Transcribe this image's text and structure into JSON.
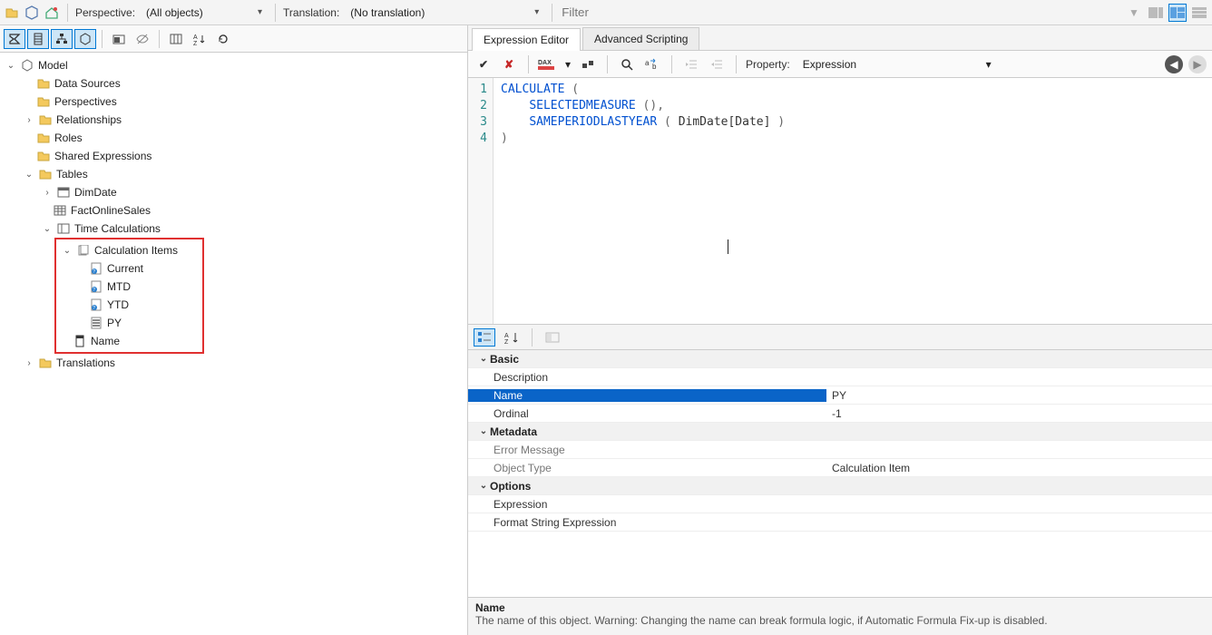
{
  "top": {
    "perspective_label": "Perspective:",
    "perspective_value": "(All objects)",
    "translation_label": "Translation:",
    "translation_value": "(No translation)",
    "filter_placeholder": "Filter"
  },
  "tree": {
    "root": "Model",
    "data_sources": "Data Sources",
    "perspectives": "Perspectives",
    "relationships": "Relationships",
    "roles": "Roles",
    "shared_expr": "Shared Expressions",
    "tables": "Tables",
    "dimdate": "DimDate",
    "factonlinesales": "FactOnlineSales",
    "timecalc": "Time Calculations",
    "calcitems": "Calculation Items",
    "ci_current": "Current",
    "ci_mtd": "MTD",
    "ci_ytd": "YTD",
    "ci_py": "PY",
    "namecol": "Name",
    "translations": "Translations"
  },
  "tabs": {
    "expr_editor": "Expression Editor",
    "adv_scripting": "Advanced Scripting"
  },
  "editor_toolbar": {
    "property_label": "Property:",
    "property_value": "Expression"
  },
  "code": {
    "l1_kw": "CALCULATE",
    "l2_kw": "SELECTEDMEASURE",
    "l3_kw": "SAMEPERIODLASTYEAR",
    "l3_arg": "DimDate[Date]"
  },
  "propgrid": {
    "cat_basic": "Basic",
    "description": "Description",
    "name": "Name",
    "name_val": "PY",
    "ordinal": "Ordinal",
    "ordinal_val": "-1",
    "cat_metadata": "Metadata",
    "err_msg": "Error Message",
    "obj_type": "Object Type",
    "obj_type_val": "Calculation Item",
    "cat_options": "Options",
    "expression": "Expression",
    "fmt_string": "Format String Expression"
  },
  "desc": {
    "title": "Name",
    "text": "The name of this object. Warning: Changing the name can break formula logic, if Automatic Formula Fix-up is disabled."
  }
}
